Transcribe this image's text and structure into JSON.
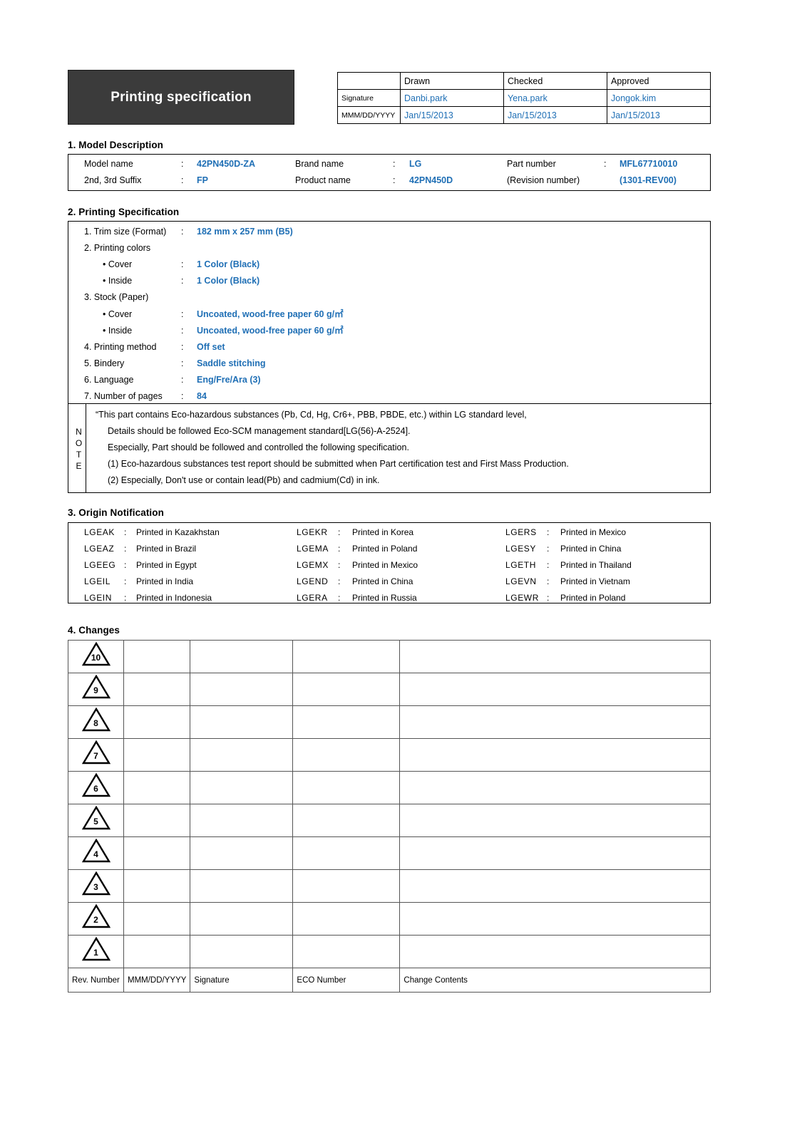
{
  "title": "Printing specification",
  "approval": {
    "columns": [
      "Drawn",
      "Checked",
      "Approved"
    ],
    "row_labels": [
      "Signature",
      "MMM/DD/YYYY"
    ],
    "signatures": [
      "Danbi.park",
      "Yena.park",
      "Jongok.kim"
    ],
    "dates": [
      "Jan/15/2013",
      "Jan/15/2013",
      "Jan/15/2013"
    ]
  },
  "sections": {
    "model": "1. Model Description",
    "printing": "2. Printing Specification",
    "origin": "3. Origin Notification",
    "changes": "4. Changes"
  },
  "model": {
    "rows": [
      [
        {
          "label": "Model name",
          "colon": ":",
          "value": "42PN450D-ZA"
        },
        {
          "label": "Brand name",
          "colon": ":",
          "value": "LG"
        },
        {
          "label": "Part number",
          "colon": ":",
          "value": "MFL67710010"
        }
      ],
      [
        {
          "label": "2nd, 3rd Suffix",
          "colon": ":",
          "value": "FP"
        },
        {
          "label": "Product name",
          "colon": ":",
          "value": "42PN450D"
        },
        {
          "label": "(Revision number)",
          "colon": "",
          "value": "(1301-REV00)"
        }
      ]
    ]
  },
  "printing": {
    "items": [
      {
        "label": "1. Trim size (Format)",
        "indent": false,
        "colon": ":",
        "value": "182 mm x 257 mm (B5)"
      },
      {
        "label": "2. Printing colors",
        "indent": false,
        "colon": "",
        "value": ""
      },
      {
        "label": "• Cover",
        "indent": true,
        "colon": ":",
        "value": "1 Color (Black)"
      },
      {
        "label": "• Inside",
        "indent": true,
        "colon": ":",
        "value": "1 Color (Black)"
      },
      {
        "label": "3. Stock (Paper)",
        "indent": false,
        "colon": "",
        "value": ""
      },
      {
        "label": "• Cover",
        "indent": true,
        "colon": ":",
        "value": "Uncoated, wood-free paper 60 g/㎡"
      },
      {
        "label": "• Inside",
        "indent": true,
        "colon": ":",
        "value": "Uncoated, wood-free paper 60 g/㎡"
      },
      {
        "label": "4. Printing method",
        "indent": false,
        "colon": ":",
        "value": "Off set"
      },
      {
        "label": "5. Bindery",
        "indent": false,
        "colon": ":",
        "value": "Saddle stitching"
      },
      {
        "label": "6. Language",
        "indent": false,
        "colon": ":",
        "value": "Eng/Fre/Ara (3)"
      },
      {
        "label": "7. Number of pages",
        "indent": false,
        "colon": ":",
        "value": "84"
      }
    ],
    "note_label": "NOTE",
    "note_lines": [
      "“This part contains Eco-hazardous substances (Pb, Cd, Hg, Cr6+, PBB, PBDE, etc.) within LG standard level,",
      "Details should be followed Eco-SCM management standard[LG(56)-A-2524].",
      "Especially, Part should be followed and controlled the following specification.",
      "(1) Eco-hazardous substances test report should be submitted when Part certification test and First Mass Production.",
      "(2) Especially, Don't use or contain lead(Pb) and cadmium(Cd) in ink."
    ]
  },
  "origin": {
    "columns": [
      [
        {
          "code": "LGEAK",
          "colon": ":",
          "name": "Printed in Kazakhstan"
        },
        {
          "code": "LGEAZ",
          "colon": ":",
          "name": "Printed in Brazil"
        },
        {
          "code": "LGEEG",
          "colon": ":",
          "name": "Printed in Egypt"
        },
        {
          "code": "LGEIL",
          "colon": ":",
          "name": "Printed in India"
        },
        {
          "code": "LGEIN",
          "colon": ":",
          "name": "Printed in Indonesia"
        }
      ],
      [
        {
          "code": "LGEKR",
          "colon": ":",
          "name": "Printed in Korea"
        },
        {
          "code": "LGEMA",
          "colon": ":",
          "name": "Printed in Poland"
        },
        {
          "code": "LGEMX",
          "colon": ":",
          "name": "Printed in Mexico"
        },
        {
          "code": "LGEND",
          "colon": ":",
          "name": "Printed in China"
        },
        {
          "code": "LGERA",
          "colon": ":",
          "name": "Printed in Russia"
        }
      ],
      [
        {
          "code": "LGERS",
          "colon": ":",
          "name": "Printed in Mexico"
        },
        {
          "code": "LGESY",
          "colon": ":",
          "name": "Printed in China"
        },
        {
          "code": "LGETH",
          "colon": ":",
          "name": "Printed in Thailand"
        },
        {
          "code": "LGEVN",
          "colon": ":",
          "name": "Printed in Vietnam"
        },
        {
          "code": "LGEWR",
          "colon": ":",
          "name": "Printed in Poland"
        }
      ]
    ]
  },
  "changes": {
    "rev_numbers": [
      "10",
      "9",
      "8",
      "7",
      "6",
      "5",
      "4",
      "3",
      "2",
      "1"
    ],
    "rows": [
      {
        "date": "",
        "signature": "",
        "eco": "",
        "contents": ""
      },
      {
        "date": "",
        "signature": "",
        "eco": "",
        "contents": ""
      },
      {
        "date": "",
        "signature": "",
        "eco": "",
        "contents": ""
      },
      {
        "date": "",
        "signature": "",
        "eco": "",
        "contents": ""
      },
      {
        "date": "",
        "signature": "",
        "eco": "",
        "contents": ""
      },
      {
        "date": "",
        "signature": "",
        "eco": "",
        "contents": ""
      },
      {
        "date": "",
        "signature": "",
        "eco": "",
        "contents": ""
      },
      {
        "date": "",
        "signature": "",
        "eco": "",
        "contents": ""
      },
      {
        "date": "",
        "signature": "",
        "eco": "",
        "contents": ""
      },
      {
        "date": "",
        "signature": "",
        "eco": "",
        "contents": ""
      }
    ],
    "footer": [
      "Rev. Number",
      "MMM/DD/YYYY",
      "Signature",
      "ECO Number",
      "Change Contents"
    ]
  },
  "colors": {
    "value_blue": "#1f6fb5",
    "banner_bg": "#3b3b3b",
    "banner_text": "#ffffff"
  }
}
